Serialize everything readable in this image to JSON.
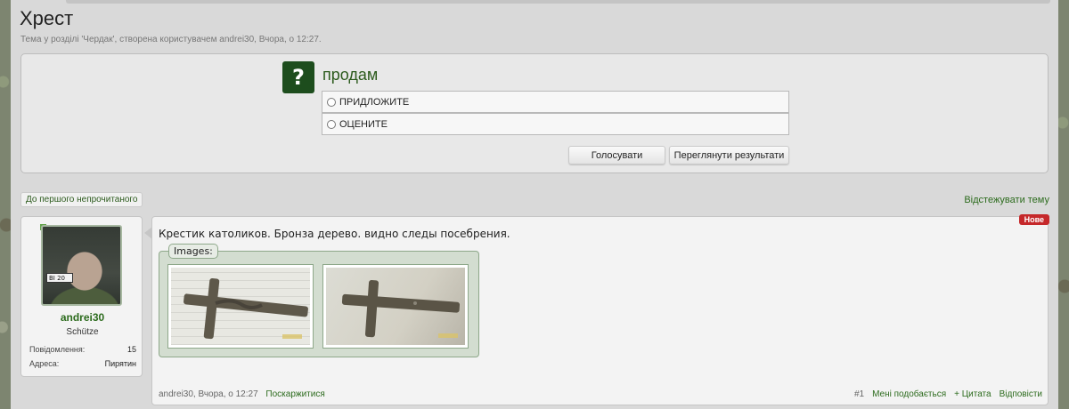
{
  "thread": {
    "title": "Хрест",
    "subtitle": "Тема у розділі 'Чердак', створена користувачем andrei30, Вчора, о 12:27."
  },
  "poll": {
    "question_icon": "question-mark-icon",
    "question_glyph": "?",
    "question": "продам",
    "options": [
      "ПРИДЛОЖИТЕ",
      "ОЦЕНИТЕ"
    ],
    "vote_button": "Голосувати",
    "results_button": "Переглянути результати"
  },
  "toolbar": {
    "first_unread": "До першого непрочитаного",
    "watch_thread": "Відстежувати тему"
  },
  "author": {
    "username": "andrei30",
    "user_title": "Schütze",
    "messages_label": "Повідомлення:",
    "messages_value": "15",
    "address_label": "Адреса:",
    "address_value": "Пирятин",
    "avatar_plate": "BI 20"
  },
  "post": {
    "new_badge": "Нове",
    "text": "Крестик католиков. Бронза дерево. видно следы посебрения.",
    "images_label": "Images:",
    "author_time": "andrei30, Вчора, о 12:27",
    "report": "Поскаржитися",
    "number": "#1",
    "like": "Мені подобається",
    "quote": "+ Цитата",
    "reply": "Відповісти"
  },
  "colors": {
    "accent_green": "#2c6b1d",
    "badge_red": "#c5282a",
    "question_bg": "#1d4d1d"
  }
}
